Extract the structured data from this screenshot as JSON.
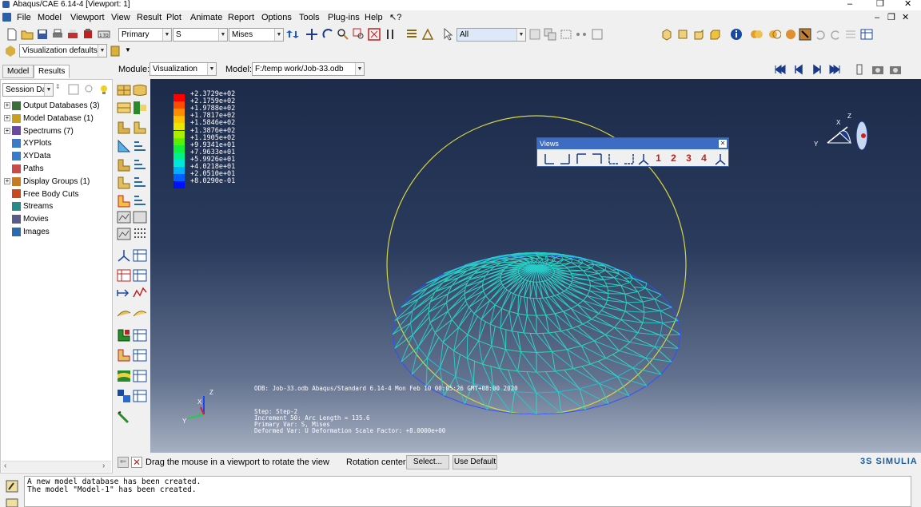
{
  "window": {
    "title": "Abaqus/CAE 6.14-4 [Viewport: 1]",
    "controls": {
      "minimize": "–",
      "maximize": "❐",
      "close": "✕"
    }
  },
  "menu": {
    "items": [
      "File",
      "Model",
      "Viewport",
      "View",
      "Result",
      "Plot",
      "Animate",
      "Report",
      "Options",
      "Tools",
      "Plug-ins",
      "Help",
      "↖?"
    ],
    "mdi_controls": [
      "–",
      "❐",
      "✕"
    ]
  },
  "toolbar": {
    "step_mode": "Primary",
    "field_variable": "S",
    "invariant": "Mises",
    "selection_filter": "All",
    "view_style": "Visualization defaults"
  },
  "context": {
    "module_label": "Module:",
    "module_value": "Visualization",
    "model_label": "Model:",
    "model_value": "F:/temp work/Job-33.odb"
  },
  "tabs": [
    "Model",
    "Results"
  ],
  "session": {
    "label": "Session Data"
  },
  "tree": [
    {
      "label": "Output Databases (3)",
      "expand": true,
      "color": "#3a6e3a"
    },
    {
      "label": "Model Database (1)",
      "expand": true,
      "color": "#c8a020"
    },
    {
      "label": "Spectrums (7)",
      "expand": true,
      "color": "#6a4aa0"
    },
    {
      "label": "XYPlots",
      "expand": false,
      "color": "#3a7ac8"
    },
    {
      "label": "XYData",
      "expand": false,
      "color": "#3a7ac8"
    },
    {
      "label": "Paths",
      "expand": false,
      "color": "#c84a4a"
    },
    {
      "label": "Display Groups (1)",
      "expand": true,
      "color": "#c87a20"
    },
    {
      "label": "Free Body Cuts",
      "expand": false,
      "color": "#c84a20"
    },
    {
      "label": "Streams",
      "expand": false,
      "color": "#2a8a8a"
    },
    {
      "label": "Movies",
      "expand": false,
      "color": "#5a5a8a"
    },
    {
      "label": "Images",
      "expand": false,
      "color": "#2a6ab0"
    }
  ],
  "legend": {
    "values": [
      "+2.3729e+02",
      "+2.1759e+02",
      "+1.9788e+02",
      "+1.7817e+02",
      "+1.5846e+02",
      "+1.3876e+02",
      "+1.1905e+02",
      "+9.9341e+01",
      "+7.9633e+01",
      "+5.9926e+01",
      "+4.0218e+01",
      "+2.0510e+01",
      "+8.0290e-01"
    ],
    "colors": [
      "#ff0000",
      "#ff4d00",
      "#ff8c00",
      "#ffc300",
      "#e8e800",
      "#a8f000",
      "#5af000",
      "#10f040",
      "#00f08c",
      "#00e8d8",
      "#00b0ff",
      "#0060ff",
      "#0010ff"
    ]
  },
  "views_dialog": {
    "title": "Views",
    "buttons": [
      "1",
      "2",
      "3",
      "4"
    ]
  },
  "viewport_info": {
    "odb_line": "ODB: Job-33.odb    Abaqus/Standard 6.14-4    Mon Feb 10 00:05:26 GMT+08:00 2020",
    "step": "Step: Step-2",
    "increment": "Increment    50: Arc Length =    135.6",
    "primary": "Primary Var: S, Mises",
    "deformed": "Deformed Var: U   Deformation Scale Factor: +8.0000e+00"
  },
  "triad": {
    "x": "X",
    "y": "Y",
    "z": "Z"
  },
  "prompt": {
    "text": "Drag the mouse in a viewport to rotate the view",
    "rotation_label": "Rotation center:",
    "select_button": "Select...",
    "default_button": "Use Default"
  },
  "brand": "SIMULIA",
  "messages": [
    "A new model database has been created.",
    "The model \"Model-1\" has been created."
  ]
}
